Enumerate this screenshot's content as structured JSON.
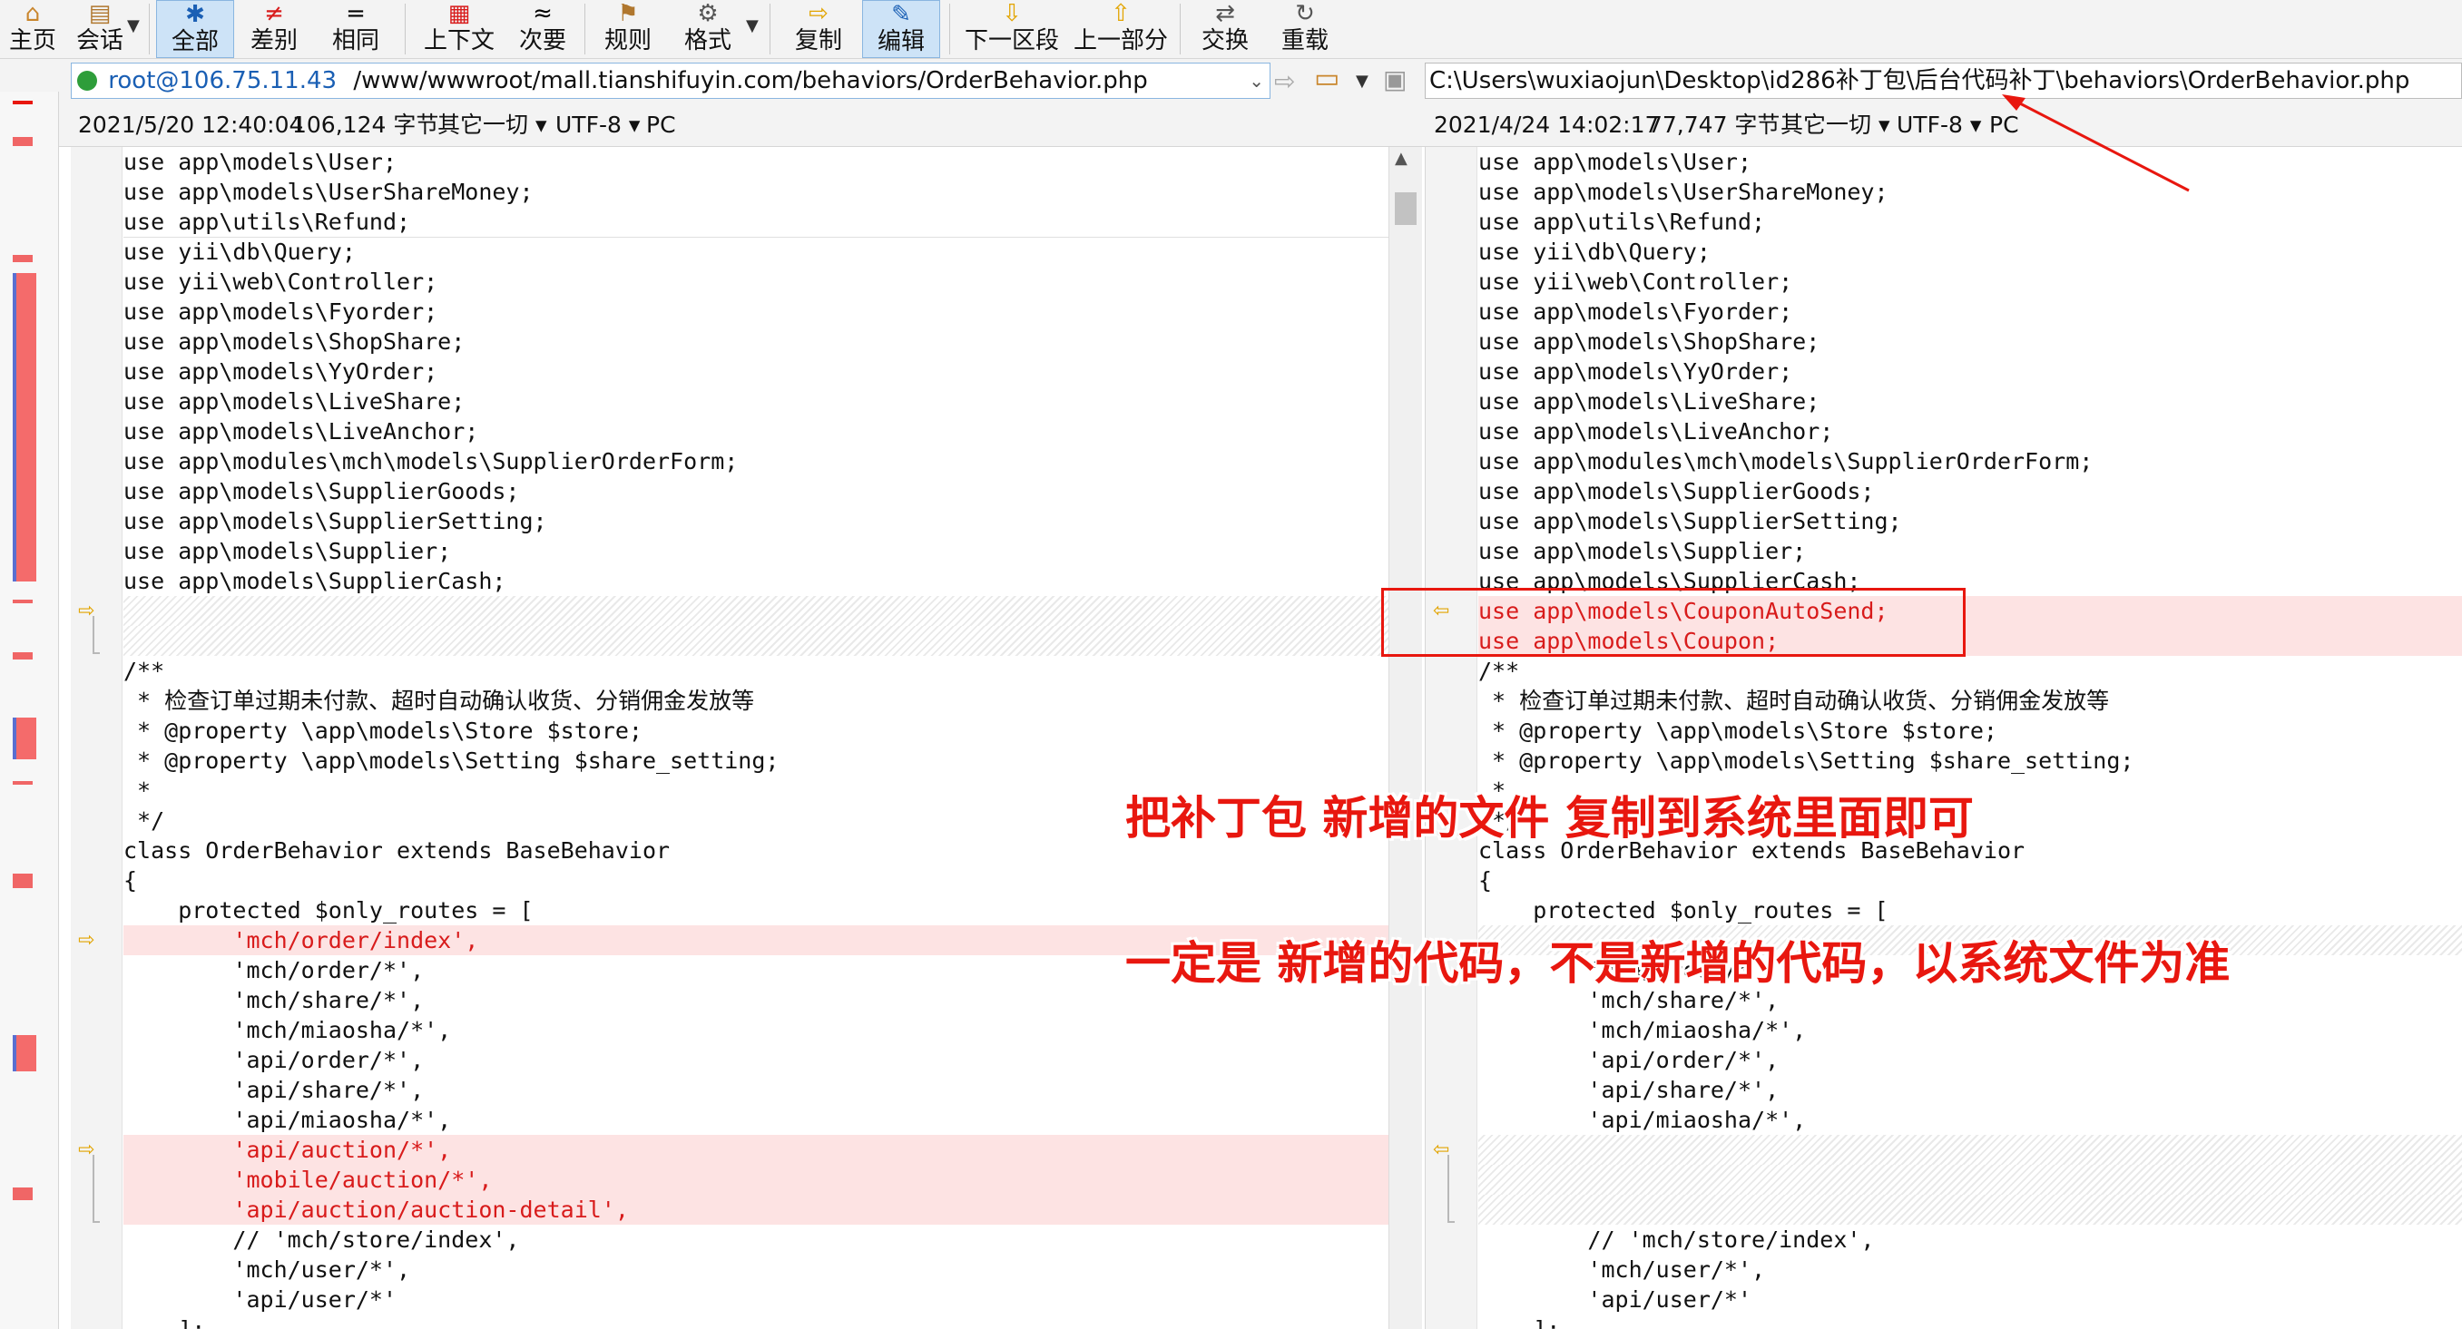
{
  "toolbar": {
    "buttons": [
      {
        "icon": "⌂",
        "label": "主页"
      },
      {
        "icon": "▤",
        "label": "会话"
      },
      {
        "icon": "✱",
        "label": "全部"
      },
      {
        "icon": "≠",
        "label": "差别"
      },
      {
        "icon": "=",
        "label": "相同"
      },
      {
        "icon": "▦",
        "label": "上下文"
      },
      {
        "icon": "≈",
        "label": "次要"
      },
      {
        "icon": "⚑",
        "label": "规则"
      },
      {
        "icon": "⚙",
        "label": "格式"
      },
      {
        "icon": "⇨",
        "label": "复制"
      },
      {
        "icon": "✎",
        "label": "编辑"
      },
      {
        "icon": "⇩",
        "label": "下一区段"
      },
      {
        "icon": "⇧",
        "label": "上一部分"
      },
      {
        "icon": "⇄",
        "label": "交换"
      },
      {
        "icon": "↻",
        "label": "重载"
      }
    ]
  },
  "left": {
    "host": "root@106.75.11.43",
    "path": "/www/wwwroot/mall.tianshifuyin.com/behaviors/OrderBehavior.php",
    "date": "2021/5/20 12:40:04",
    "size": "106,124 字节",
    "category": "其它一切",
    "encoding": "UTF-8",
    "lineend": "PC",
    "lines": [
      "use app\\models\\User;",
      "use app\\models\\UserShareMoney;",
      "use app\\utils\\Refund;",
      "use yii\\db\\Query;",
      "use yii\\web\\Controller;",
      "use app\\models\\Fyorder;",
      "use app\\models\\ShopShare;",
      "use app\\models\\YyOrder;",
      "use app\\models\\LiveShare;",
      "use app\\models\\LiveAnchor;",
      "use app\\modules\\mch\\models\\SupplierOrderForm;",
      "use app\\models\\SupplierGoods;",
      "use app\\models\\SupplierSetting;",
      "use app\\models\\Supplier;",
      "use app\\models\\SupplierCash;",
      "",
      "",
      "/**",
      " * 检查订单过期未付款、超时自动确认收货、分销佣金发放等",
      " * @property \\app\\models\\Store $store;",
      " * @property \\app\\models\\Setting $share_setting;",
      " *",
      " */",
      "class OrderBehavior extends BaseBehavior",
      "{",
      "    protected $only_routes = [",
      "        'mch/order/index',",
      "        'mch/order/*',",
      "        'mch/share/*',",
      "        'mch/miaosha/*',",
      "        'api/order/*',",
      "        'api/share/*',",
      "        'api/miaosha/*',",
      "        'api/auction/*',",
      "        'mobile/auction/*',",
      "        'api/auction/auction-detail',",
      "        // 'mch/store/index',",
      "        'mch/user/*',",
      "        'api/user/*'",
      "    ];"
    ]
  },
  "right": {
    "path": "C:\\Users\\wuxiaojun\\Desktop\\id286补丁包\\后台代码补丁\\behaviors\\OrderBehavior.php",
    "date": "2021/4/24 14:02:17",
    "size": "77,747 字节",
    "category": "其它一切",
    "encoding": "UTF-8",
    "lineend": "PC",
    "lines": [
      "use app\\models\\User;",
      "use app\\models\\UserShareMoney;",
      "use app\\utils\\Refund;",
      "use yii\\db\\Query;",
      "use yii\\web\\Controller;",
      "use app\\models\\Fyorder;",
      "use app\\models\\ShopShare;",
      "use app\\models\\YyOrder;",
      "use app\\models\\LiveShare;",
      "use app\\models\\LiveAnchor;",
      "use app\\modules\\mch\\models\\SupplierOrderForm;",
      "use app\\models\\SupplierGoods;",
      "use app\\models\\SupplierSetting;",
      "use app\\models\\Supplier;",
      "use app\\models\\SupplierCash;",
      "use app\\models\\CouponAutoSend;",
      "use app\\models\\Coupon;",
      "/**",
      " * 检查订单过期未付款、超时自动确认收货、分销佣金发放等",
      " * @property \\app\\models\\Store $store;",
      " * @property \\app\\models\\Setting $share_setting;",
      " *",
      " */",
      "class OrderBehavior extends BaseBehavior",
      "{",
      "    protected $only_routes = [",
      "",
      "        'mch/order/*',",
      "        'mch/share/*',",
      "        'mch/miaosha/*',",
      "        'api/order/*',",
      "        'api/share/*',",
      "        'api/miaosha/*',",
      "",
      "",
      "",
      "        // 'mch/store/index',",
      "        'mch/user/*',",
      "        'api/user/*'",
      "    ];"
    ]
  },
  "annotations": {
    "line1": "把补丁包  新增的文件  复制到系统里面即可",
    "line2": "一定是    新增的代码，不是新增的代码，以系统文件为准"
  },
  "colors": {
    "accent": "#1a5fb4",
    "diff_bg": "#fde3e3",
    "diff_text": "#d81b1b",
    "annotation": "#e8170f"
  }
}
